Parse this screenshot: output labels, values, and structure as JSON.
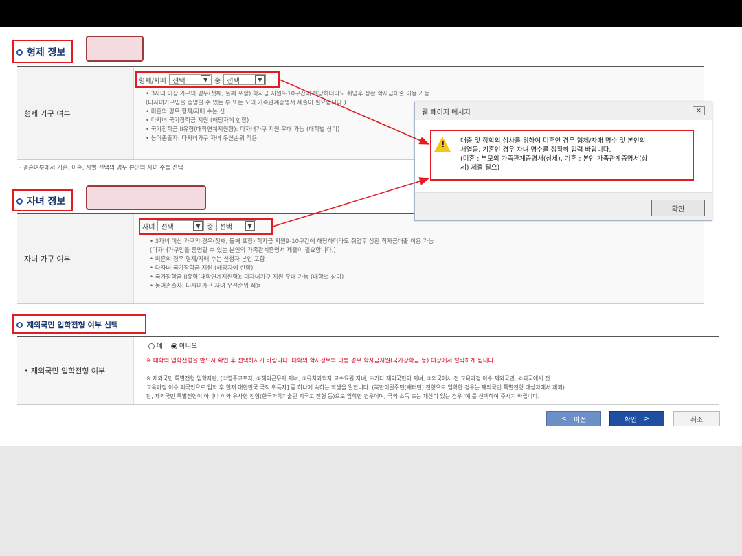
{
  "sibling_section": {
    "title": "형제 정보",
    "row_label": "형제 가구 여부",
    "select_prefix": "형제/자매",
    "select1": "선택",
    "connector": "중",
    "select2": "선택",
    "notes": [
      "• 3자녀 이상 가구의 경우(첫째, 둘째 포함) 학자금 지원9-10구간에 해당하더라도 취업후 상환 학자금대출 이용 가능",
      "  (다자녀가구임을 증명할 수 있는 부 또는 모의 가족관계증명서 제출이 필요합니다.)",
      "• 미혼의 경우 형제/자매 수는 신",
      "• 다자녀 국가장학금 지원 (해당자에 한함)",
      "• 국가장학금 II유형(대학연계지원형): 다자녀가구 지원 우대 가능 (대학별 상이)",
      "• 농어촌출자: 다자녀가구 자녀 우선순위 적용"
    ]
  },
  "marital_note": "· 결혼여부에서 기혼, 이혼, 사별 선택의 경우 본인의 자녀 수를 선택",
  "children_section": {
    "title": "자녀 정보",
    "row_label": "자녀 가구 여부",
    "select_prefix": "자녀",
    "select1": "선택",
    "connector": "중",
    "select2": "선택",
    "notes": [
      "• 3자녀 이상 가구의 경우(첫째, 둘째 포함) 학자금 지원9-10구간에 해당하더라도 취업후 상환 학자금대출 이용 가능",
      "  (다자녀가구임을 증명할 수 있는 본인의 가족관계증명서 제출이 필요합니다.)",
      "• 미혼의 경우 형제/자매 수는 신청자 본인 포함",
      "• 다자녀 국가장학금 지원 (해당자에 한함)",
      "• 국가장학금 II유형(대학연계지원형): 다자녀가구 지원 우대 가능 (대학별 상이)",
      "• 농어촌출자: 다자녀가구 자녀 우선순위 적용"
    ]
  },
  "dialog": {
    "title": "웹 페이지 메시지",
    "close": "✕",
    "message_lines": [
      "대출 및 장학의 심사를 위하여 미혼인 경우 형제/자매 명수 및 본인의",
      "서열을, 기혼인 경우 자녀 명수를 정확히 입력 바랍니다.",
      "(미혼 : 부모의 가족관계증명서(상세), 기혼 : 본인 가족관계증명서(상",
      "세) 제출 필요)"
    ],
    "ok": "확인"
  },
  "overseas_section": {
    "title": "재외국민 입학전형 여부 선택",
    "row_label": "• 재외국민 입학전형 여부",
    "option_yes": "예",
    "option_no": "아니오",
    "warning": "※ 대학의 입학전형을 반드시 확인 후 선택하시기 바랍니다. 대학의 학사정보와 다를 경우 학자금지원(국가장학금 등) 대상에서 탈락하게 됩니다.",
    "desc_lines": [
      "※ 재외국민 특별전형 입학자란, [①영주교포자, ②해외근무자 자녀, ③유치과학자·교수요원 자녀, ④기타 재외국민의 자녀, ⑤외국에서 전 교육과정 이수 재외국민, ⑥외국에서 전",
      "교육과정 이수 외국인으로 입학 후 현재 대한민국 국적 취득자] 중 하나에 속하는 학생을 말합니다. (북한이탈주민(새터민) 전형으로 입학한 경우는 재외국민 특별전형 대상자에서 제외)",
      "단, 재외국민 특별전형이 아니나 이와 유사한 전형(한국과학기술원 외국고 전형 등)으로 입학한 경우이며, 국외 소득 또는 재산이 있는 경우 '예'를 선택하여 주시기 바랍니다."
    ]
  },
  "buttons": {
    "prev": "이전",
    "confirm": "확인",
    "cancel": "취소"
  },
  "colors": {
    "highlight": "#e31b23",
    "primary_button": "#1e4fa3",
    "prev_button": "#6b8fc6",
    "warning_text": "#d0021b"
  }
}
